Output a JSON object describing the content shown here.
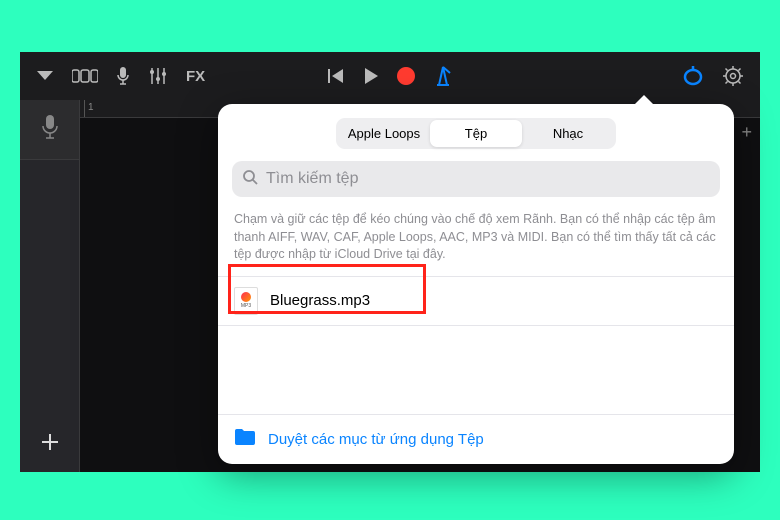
{
  "toolbar": {
    "fx_label": "FX"
  },
  "popover": {
    "tabs": {
      "apple_loops": "Apple Loops",
      "files": "Tệp",
      "music": "Nhạc"
    },
    "search_placeholder": "Tìm kiếm tệp",
    "hint": "Chạm và giữ các tệp để kéo chúng vào chế độ xem Rãnh. Bạn có thể nhập các tệp âm thanh AIFF, WAV, CAF, Apple Loops, AAC, MP3 và MIDI. Bạn có thể tìm thấy tất cả các tệp được nhập từ iCloud Drive tại đây.",
    "files": [
      {
        "name": "Bluegrass.mp3",
        "ext": "MP3"
      }
    ],
    "footer_label": "Duyệt các mục từ ứng dụng Tệp"
  },
  "ruler": {
    "marks": [
      "1"
    ]
  }
}
